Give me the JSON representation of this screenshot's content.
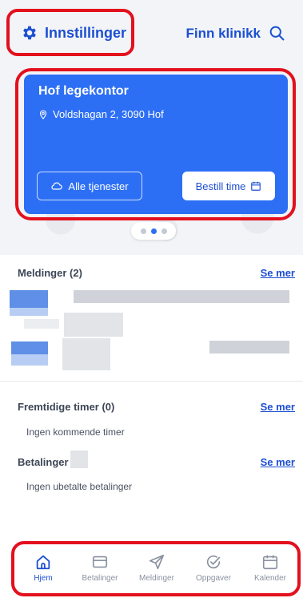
{
  "header": {
    "settings_label": "Innstillinger",
    "find_clinic_label": "Finn klinikk"
  },
  "clinic_card": {
    "name": "Hof legekontor",
    "address": "Voldshagan 2, 3090 Hof",
    "services_button": "Alle tjenester",
    "book_button": "Bestill time",
    "pager_total": 3,
    "pager_active": 2
  },
  "sections": {
    "messages": {
      "title": "Meldinger (2)",
      "see_more": "Se mer"
    },
    "appointments": {
      "title": "Fremtidige timer (0)",
      "see_more": "Se mer",
      "empty": "Ingen kommende timer"
    },
    "payments": {
      "title": "Betalinger",
      "see_more": "Se mer",
      "empty": "Ingen ubetalte betalinger"
    }
  },
  "bottom_nav": {
    "items": [
      {
        "label": "Hjem",
        "icon": "home-icon",
        "active": true
      },
      {
        "label": "Betalinger",
        "icon": "card-icon",
        "active": false
      },
      {
        "label": "Meldinger",
        "icon": "send-icon",
        "active": false
      },
      {
        "label": "Oppgaver",
        "icon": "check-circle-icon",
        "active": false
      },
      {
        "label": "Kalender",
        "icon": "calendar-icon",
        "active": false
      }
    ]
  },
  "colors": {
    "brand_blue": "#1d4fd1",
    "card_blue": "#2d6ff4",
    "highlight_red": "#e3101d"
  }
}
